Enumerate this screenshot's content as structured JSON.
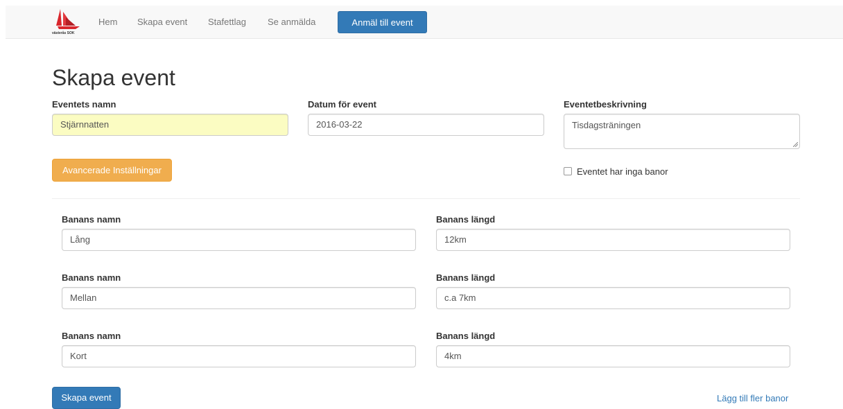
{
  "nav": {
    "logo_text": "västerås SOK",
    "links": [
      "Hem",
      "Skapa event",
      "Stafettlag",
      "Se anmälda"
    ],
    "cta": "Anmäl till event"
  },
  "page": {
    "title": "Skapa event"
  },
  "form": {
    "event_name": {
      "label": "Eventets namn",
      "value": "Stjärnnatten"
    },
    "event_date": {
      "label": "Datum för event",
      "value": "2016-03-22"
    },
    "event_description": {
      "label": "Eventetbeskrivning",
      "value": "Tisdagsträningen"
    },
    "advanced_button": "Avancerade Inställningar",
    "no_courses_label": "Eventet har inga banor",
    "courses": [
      {
        "name_label": "Banans namn",
        "name_value": "Lång",
        "length_label": "Banans längd",
        "length_value": "12km"
      },
      {
        "name_label": "Banans namn",
        "name_value": "Mellan",
        "length_label": "Banans längd",
        "length_value": "c.a 7km"
      },
      {
        "name_label": "Banans namn",
        "name_value": "Kort",
        "length_label": "Banans längd",
        "length_value": "4km"
      }
    ],
    "submit_button": "Skapa event",
    "add_courses_link": "Lägg till fler banor"
  },
  "colors": {
    "primary": "#337ab7",
    "warning": "#f0ad4e",
    "highlight_input": "#fbfcc2",
    "logo_red": "#d9262c"
  }
}
